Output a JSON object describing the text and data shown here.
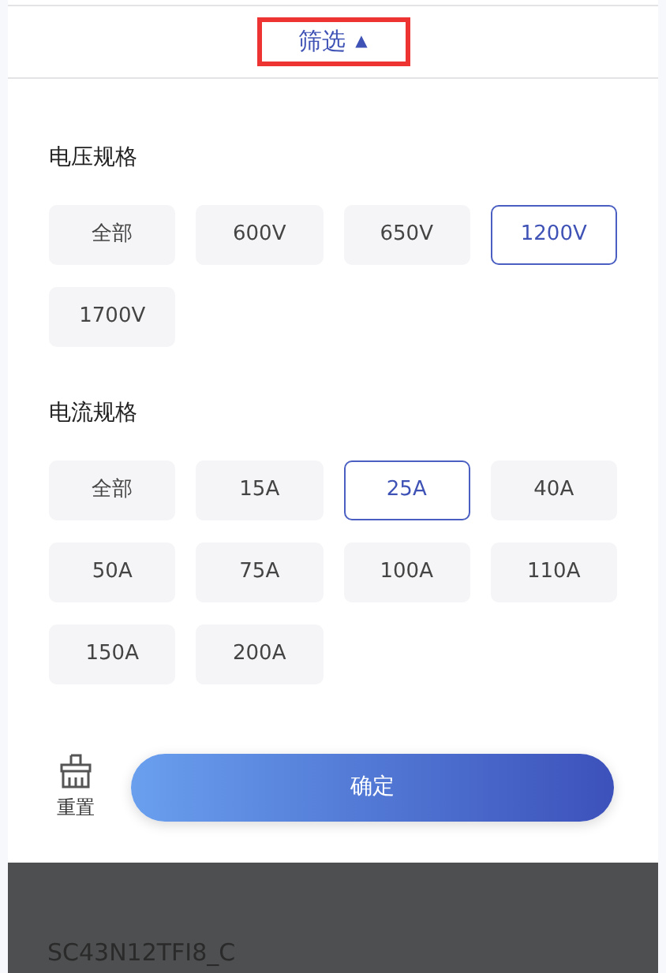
{
  "header": {
    "title": "筛选",
    "arrow": "▲",
    "highlighted": true
  },
  "sections": [
    {
      "title": "电压规格",
      "options": [
        {
          "label": "全部",
          "selected": false
        },
        {
          "label": "600V",
          "selected": false
        },
        {
          "label": "650V",
          "selected": false
        },
        {
          "label": "1200V",
          "selected": true
        },
        {
          "label": "1700V",
          "selected": false
        }
      ]
    },
    {
      "title": "电流规格",
      "options": [
        {
          "label": "全部",
          "selected": false
        },
        {
          "label": "15A",
          "selected": false
        },
        {
          "label": "25A",
          "selected": true
        },
        {
          "label": "40A",
          "selected": false
        },
        {
          "label": "50A",
          "selected": false
        },
        {
          "label": "75A",
          "selected": false
        },
        {
          "label": "100A",
          "selected": false
        },
        {
          "label": "110A",
          "selected": false
        },
        {
          "label": "150A",
          "selected": false
        },
        {
          "label": "200A",
          "selected": false
        }
      ]
    }
  ],
  "footer": {
    "reset": "重置",
    "confirm": "确定"
  },
  "background_list": {
    "item": "SC43N12TFI8_C"
  }
}
